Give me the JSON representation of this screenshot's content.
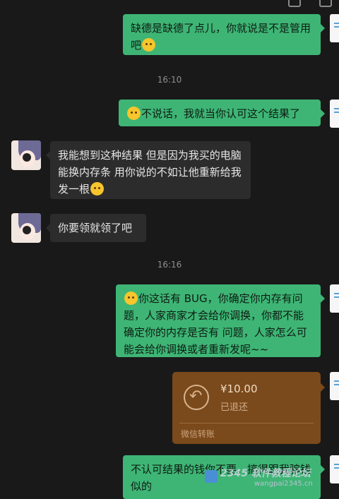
{
  "messages": [
    {
      "id": "m1",
      "side": "right",
      "text_before": "缺德是缺德了点儿，你就说是不是管用吧",
      "emoji": "grin-sweat-emoji"
    },
    {
      "id": "m2",
      "side": "right",
      "text": "不说话，我就当你认可这个结果了",
      "emoji": "hush-emoji"
    },
    {
      "id": "m3",
      "side": "left",
      "text": "我能想到这种结果 但是因为我买的电脑能换内存条 用你说的不如让他重新给我发一根",
      "emoji": "grin-sweat-emoji"
    },
    {
      "id": "m4",
      "side": "left",
      "text": "你要领就领了吧"
    },
    {
      "id": "m5",
      "side": "right",
      "text": "你这话有 BUG，你确定你内存有问题，人家商家才会给你调换，你都不能确定你的内存是否有  问题，人家怎么可能会给你调换或者重新发呢~~",
      "emoji": "smirk-emoji"
    },
    {
      "id": "m7",
      "side": "right",
      "text": "不认可结果的钱你不要，搞得跟我骗钱似的"
    }
  ],
  "timestamps": {
    "t1": "16:10",
    "t2": "16:16"
  },
  "transfer": {
    "amount": "¥10.00",
    "status": "已退还",
    "label": "微信转账"
  },
  "watermark": {
    "brand": "2345 软件教程论坛",
    "url": "wangpai2345.cn"
  },
  "colors": {
    "background": "#191919",
    "bubble_self": "#3eb575",
    "bubble_other": "#2c2c2c",
    "transfer": "#7b4a1c"
  }
}
